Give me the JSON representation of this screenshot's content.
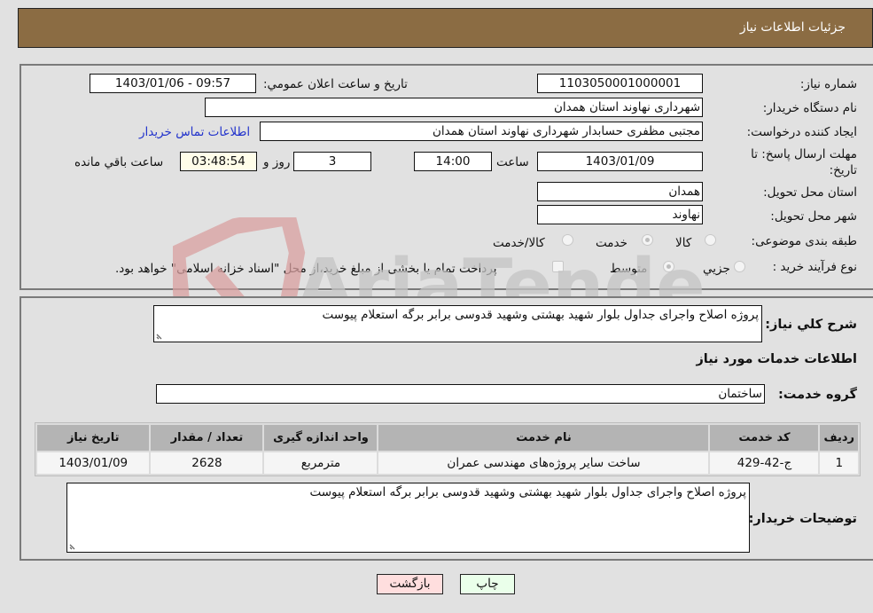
{
  "header": {
    "title": "جزئیات اطلاعات نیاز"
  },
  "fields": {
    "need_number_label": "شماره نیاز:",
    "need_number": "1103050001000001",
    "announce_label": "تاریخ و ساعت اعلان عمومي:",
    "announce_value": "1403/01/06 - 09:57",
    "buyer_org_label": "نام دستگاه خریدار:",
    "buyer_org": "شهرداری نهاوند استان همدان",
    "creator_label": "ایجاد کننده درخواست:",
    "creator": "مجتبی مظفری حسابدار شهرداری نهاوند استان همدان",
    "contact_link": "اطلاعات تماس خریدار",
    "deadline_label": "مهلت ارسال پاسخ: تا تاریخ:",
    "deadline_date": "1403/01/09",
    "time_label": "ساعت",
    "deadline_time": "14:00",
    "days_value": "3",
    "days_label": "روز و",
    "remaining_time": "03:48:54",
    "remaining_label": "ساعت باقي مانده",
    "province_label": "استان محل تحویل:",
    "province": "همدان",
    "city_label": "شهر محل تحویل:",
    "city": "نهاوند",
    "category_label": "طبقه بندی موضوعی:",
    "category_options": [
      {
        "label": "کالا",
        "checked": false
      },
      {
        "label": "خدمت",
        "checked": true
      },
      {
        "label": "کالا/خدمت",
        "checked": false
      }
    ],
    "process_label": "نوع فرآیند خرید :",
    "process_options": [
      {
        "label": "جزيي",
        "checked": false
      },
      {
        "label": "متوسط",
        "checked": true
      }
    ],
    "treasury_note": "پرداخت تمام یا بخشی از مبلغ خرید،از محل \"اسناد خزانه اسلامی\" خواهد بود.",
    "treasury_checked": false
  },
  "description": {
    "label": "شرح كلي نياز:",
    "text": "پروژه اصلاح واجرای جداول بلوار شهید بهشتی وشهید قدوسی برابر برگه استعلام پیوست"
  },
  "services": {
    "section_title": "اطلاعات خدمات مورد نياز",
    "group_label": "گروه خدمت:",
    "group_value": "ساختمان",
    "columns": [
      "ردیف",
      "کد خدمت",
      "نام خدمت",
      "واحد اندازه گیری",
      "تعداد / مقدار",
      "تاریخ نیاز"
    ],
    "rows": [
      [
        "1",
        "ج-42-429",
        "ساخت سایر پروژه‌های مهندسی عمران",
        "مترمربع",
        "2628",
        "1403/01/09"
      ]
    ]
  },
  "buyer_notes": {
    "label": "توضیحات خریدار:",
    "text": "پروژه اصلاح واجرای جداول بلوار شهید بهشتی وشهید قدوسی برابر برگه استعلام پیوست"
  },
  "buttons": {
    "print": "چاپ",
    "back": "بازگشت"
  },
  "watermark": {
    "text": "AriaTender.neT"
  },
  "colors": {
    "header_bg": "#8b6c43",
    "link": "#2233cc",
    "back_btn": "#ffdede",
    "print_btn": "#eaffea"
  }
}
